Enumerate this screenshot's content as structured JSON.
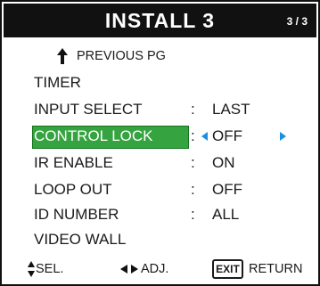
{
  "menu": {
    "title": "INSTALL 3",
    "page": "3 / 3",
    "previous_label": "PREVIOUS PG",
    "items": [
      {
        "label": "TIMER",
        "value": ""
      },
      {
        "label": "INPUT SELECT",
        "value": "LAST"
      },
      {
        "label": "CONTROL LOCK",
        "value": "OFF",
        "selected": true
      },
      {
        "label": "IR ENABLE",
        "value": "ON"
      },
      {
        "label": "LOOP OUT",
        "value": "OFF"
      },
      {
        "label": "ID NUMBER",
        "value": "ALL"
      },
      {
        "label": "VIDEO WALL",
        "value": ""
      }
    ],
    "separator": ":"
  },
  "footer": {
    "sel_label": "SEL.",
    "adj_label": "ADJ.",
    "exit_key": "EXIT",
    "return_label": "RETURN"
  },
  "colors": {
    "highlight": "#36a341",
    "arrow": "#1c8fe3",
    "title_bg": "#111111"
  },
  "icons": {
    "previous": "up-arrow-icon",
    "sel": "up-down-arrows-icon",
    "adj": "left-right-arrows-icon"
  }
}
